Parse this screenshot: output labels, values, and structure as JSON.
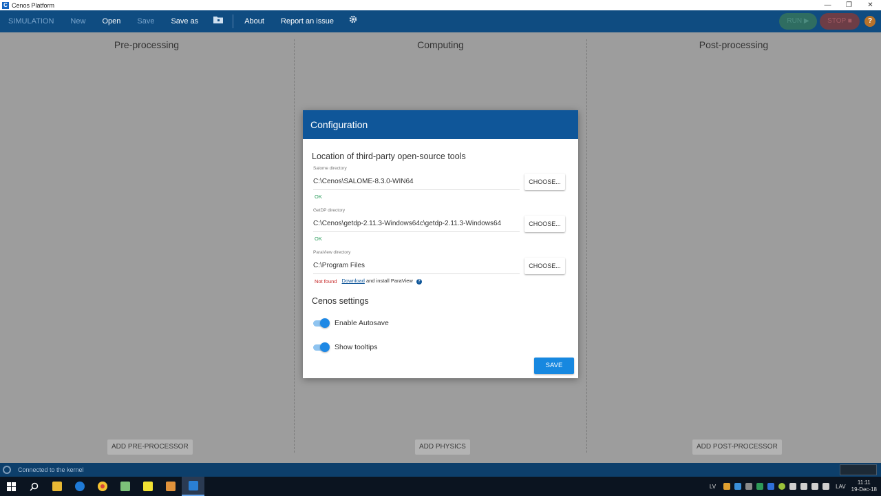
{
  "window": {
    "title": "Cenos Platform",
    "controls": [
      "—",
      "❐",
      "✕"
    ]
  },
  "toolbar": {
    "simulation": "SIMULATION",
    "new": "New",
    "open": "Open",
    "save": "Save",
    "save_as": "Save as",
    "about": "About",
    "report": "Report an issue",
    "run": "RUN ▶",
    "stop": "STOP ■",
    "help": "?"
  },
  "columns": {
    "pre": {
      "title": "Pre-processing",
      "button": "ADD PRE-PROCESSOR"
    },
    "computing": {
      "title": "Computing",
      "button": "ADD PHYSICS"
    },
    "post": {
      "title": "Post-processing",
      "button": "ADD POST-PROCESSOR"
    }
  },
  "dialog": {
    "title": "Configuration",
    "tools_section": "Location of third-party open-source tools",
    "salome": {
      "label": "Salome directory",
      "value": "C:\\Cenos\\SALOME-8.3.0-WIN64",
      "status": "OK",
      "button": "CHOOSE..."
    },
    "getdp": {
      "label": "GetDP directory",
      "value": "C:\\Cenos\\getdp-2.11.3-Windows64c\\getdp-2.11.3-Windows64",
      "status": "OK",
      "button": "CHOOSE..."
    },
    "paraview": {
      "label": "ParaView directory",
      "value": "C:\\Program Files",
      "status": "Not found",
      "download_link": "Download",
      "download_rest": "and install ParaView",
      "button": "CHOOSE..."
    },
    "settings_section": "Cenos settings",
    "autosave": {
      "label": "Enable Autosave",
      "enabled": true
    },
    "tooltips": {
      "label": "Show tooltips",
      "enabled": true
    },
    "save_button": "SAVE"
  },
  "statusbar": {
    "text": "Connected to the kernel"
  },
  "taskbar": {
    "language": "LV",
    "keyboard": "LAV",
    "time": "11:11",
    "date": "19-Dec-18"
  },
  "colors": {
    "toolbar": "#0f4c81",
    "dialog_header": "#0f5699",
    "save": "#1788e0",
    "ok": "#2e9e5e",
    "not_found": "#c62828"
  }
}
